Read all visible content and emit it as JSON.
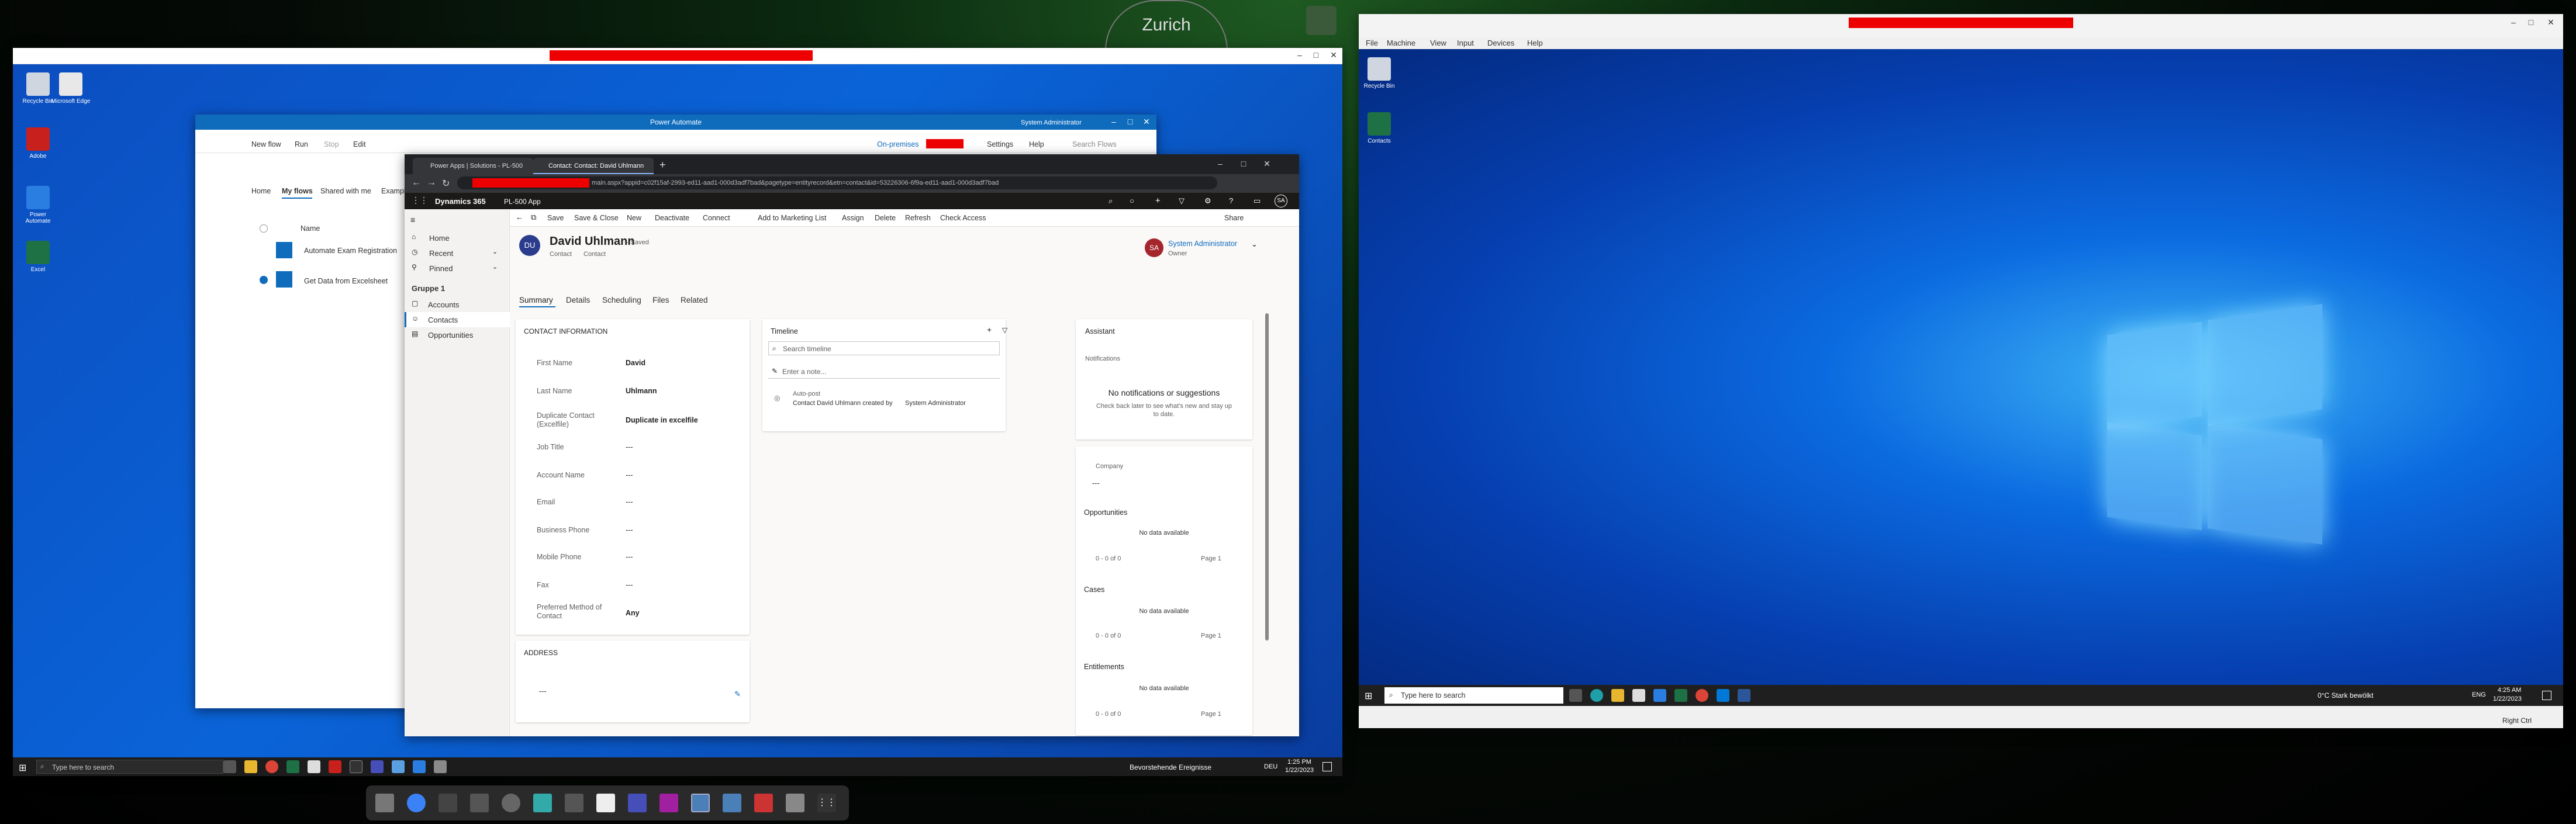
{
  "clock_widget": {
    "city": "Zurich"
  },
  "left_desktop": {
    "icons": [
      "Recycle Bin",
      "Microsoft Edge",
      "Adobe",
      "Power Automate",
      "Excel"
    ],
    "back_window": {
      "title": ""
    },
    "taskbar": {
      "search_placeholder": "Type here to search",
      "notification": "Bevorstehende Ereignisse",
      "lang": "DEU",
      "time": "1:25 PM",
      "date": "1/22/2023"
    }
  },
  "power_automate": {
    "title": "Power Automate",
    "toolbar": [
      "New flow",
      "Run",
      "Stop",
      "Edit"
    ],
    "on_premises": "On-premises",
    "settings": "Settings",
    "help": "Help",
    "search_placeholder": "Search Flows",
    "user": "System Administrator",
    "tabs": [
      "Home",
      "My flows",
      "Shared with me",
      "Examples"
    ],
    "column_name": "Name",
    "flows": [
      "Automate Exam Registration",
      "Get Data from Excelsheet"
    ]
  },
  "browser": {
    "tabs": [
      "Power Apps | Solutions - PL-500",
      "Contact: Contact: David Uhlmann"
    ],
    "url_suffix": "main.aspx?appid=c02f15af-2993-ed11-aad1-000d3adf7bad&pagetype=entityrecord&etn=contact&id=53226306-6f9a-ed11-aad1-000d3adf7bad"
  },
  "d365": {
    "brand": "Dynamics 365",
    "app": "PL-500 App",
    "user_initials": "SA",
    "nav": {
      "home": "Home",
      "recent": "Recent",
      "pinned": "Pinned",
      "group": "Gruppe 1",
      "items": [
        "Accounts",
        "Contacts",
        "Opportunities"
      ]
    },
    "commands": [
      "Save",
      "Save & Close",
      "New",
      "Deactivate",
      "Connect",
      "Add to Marketing List",
      "Assign",
      "Delete",
      "Refresh",
      "Check Access",
      "Share"
    ],
    "record": {
      "initials": "DU",
      "name": "David Uhlmann",
      "saved": "- Saved",
      "entity": "Contact",
      "form": "Contact",
      "owner_initials": "SA",
      "owner_name": "System Administrator",
      "owner_label": "Owner"
    },
    "tabs": [
      "Summary",
      "Details",
      "Scheduling",
      "Files",
      "Related"
    ],
    "contact_info": {
      "heading": "CONTACT INFORMATION",
      "fields": [
        {
          "label": "First Name",
          "value": "David"
        },
        {
          "label": "Last Name",
          "value": "Uhlmann"
        },
        {
          "label": "Duplicate Contact (Excelfile)",
          "value": "Duplicate in excelfile"
        },
        {
          "label": "Job Title",
          "value": "---"
        },
        {
          "label": "Account Name",
          "value": "---"
        },
        {
          "label": "Email",
          "value": "---"
        },
        {
          "label": "Business Phone",
          "value": "---"
        },
        {
          "label": "Mobile Phone",
          "value": "---"
        },
        {
          "label": "Fax",
          "value": "---"
        },
        {
          "label": "Preferred Method of Contact",
          "value": "Any"
        }
      ]
    },
    "address": {
      "heading": "ADDRESS",
      "value": "---"
    },
    "timeline": {
      "heading": "Timeline",
      "search_placeholder": "Search timeline",
      "note_placeholder": "Enter a note...",
      "post_type": "Auto-post",
      "post_text": "Contact David Uhlmann created by",
      "post_author": "System Administrator"
    },
    "assistant": {
      "heading": "Assistant",
      "sub": "Notifications",
      "empty_title": "No notifications or suggestions",
      "empty_text": "Check back later to see what's new and stay up to date."
    },
    "related": {
      "company_label": "Company",
      "company_value": "---",
      "sections": [
        {
          "title": "Opportunities",
          "empty": "No data available",
          "count": "0 - 0 of 0",
          "page": "Page 1"
        },
        {
          "title": "Cases",
          "empty": "No data available",
          "count": "0 - 0 of 0",
          "page": "Page 1"
        },
        {
          "title": "Entitlements",
          "empty": "No data available",
          "count": "0 - 0 of 0",
          "page": "Page 1"
        }
      ]
    }
  },
  "vm": {
    "menu": [
      "File",
      "Machine",
      "View",
      "Input",
      "Devices",
      "Help"
    ],
    "icons": [
      "Recycle Bin",
      "Contacts"
    ],
    "taskbar": {
      "search_placeholder": "Type here to search",
      "weather": "0°C  Stark bewölkt",
      "lang": "ENG",
      "time": "4:25 AM",
      "date": "1/22/2023"
    },
    "status": "Right Ctrl"
  },
  "colors": {
    "accent": "#0f6cbd",
    "d365_bar": "#1b1a19",
    "win_blue": "#0a5fd1",
    "redact": "#e00000"
  }
}
